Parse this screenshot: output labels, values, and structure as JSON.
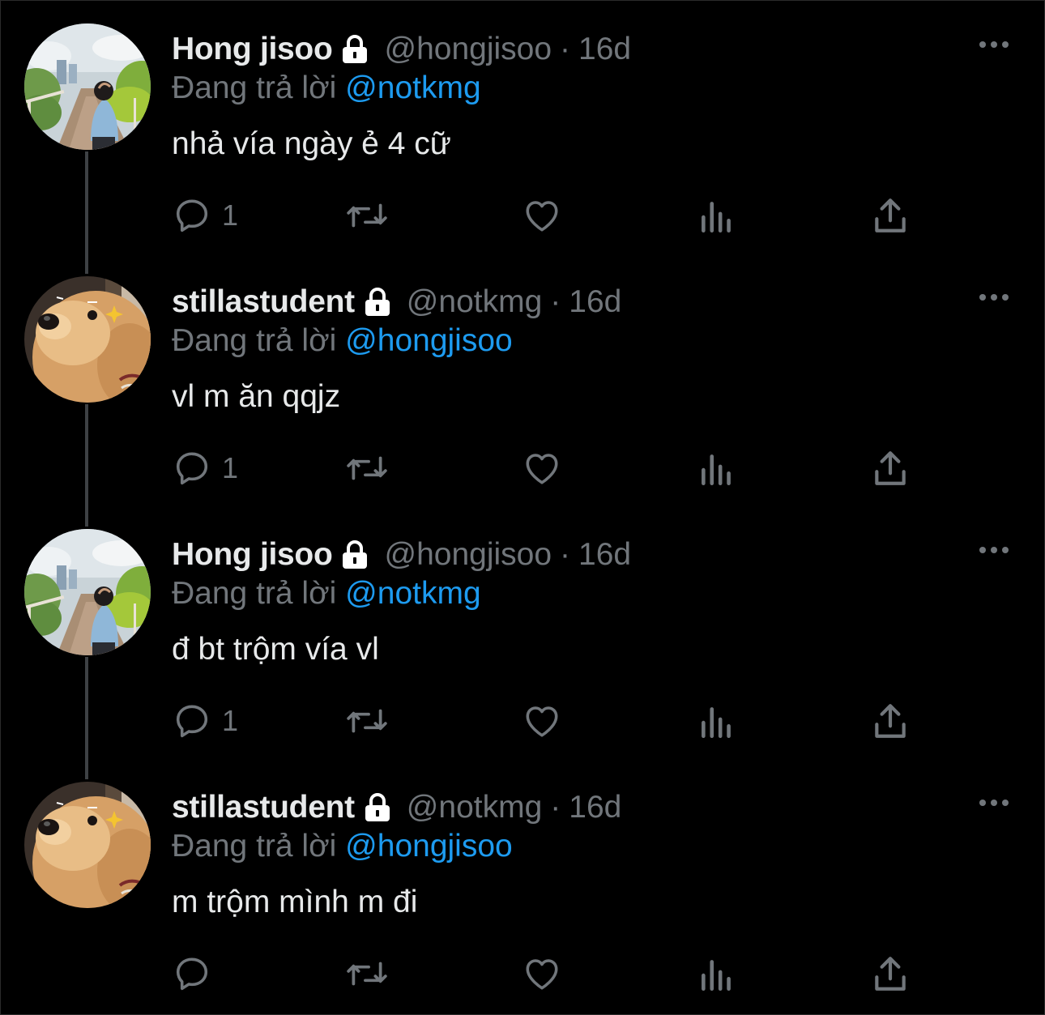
{
  "colors": {
    "background": "#000000",
    "text": "#e7e9ea",
    "muted": "#71767b",
    "link": "#1d9bf0",
    "thread_line": "#3e4144"
  },
  "tweets": [
    {
      "display_name": "Hong jisoo",
      "handle": "@hongjisoo",
      "separator": "·",
      "time": "16d",
      "reply_prefix": "Đang trả lời",
      "reply_to": "@notkmg",
      "text": "nhả vía ngày ẻ 4 cữ",
      "reply_count": "1",
      "avatar": "person-avatar",
      "protected_icon": "lock-icon"
    },
    {
      "display_name": "stillastudent",
      "handle": "@notkmg",
      "separator": "·",
      "time": "16d",
      "reply_prefix": "Đang trả lời",
      "reply_to": "@hongjisoo",
      "text": "vl m ăn qqjz",
      "reply_count": "1",
      "avatar": "dog-avatar",
      "protected_icon": "lock-icon"
    },
    {
      "display_name": "Hong jisoo",
      "handle": "@hongjisoo",
      "separator": "·",
      "time": "16d",
      "reply_prefix": "Đang trả lời",
      "reply_to": "@notkmg",
      "text": "đ bt trộm vía vl",
      "reply_count": "1",
      "avatar": "person-avatar",
      "protected_icon": "lock-icon"
    },
    {
      "display_name": "stillastudent",
      "handle": "@notkmg",
      "separator": "·",
      "time": "16d",
      "reply_prefix": "Đang trả lời",
      "reply_to": "@hongjisoo",
      "text": "m trộm mình m đi",
      "reply_count": "",
      "avatar": "dog-avatar",
      "protected_icon": "lock-icon"
    }
  ],
  "action_icons": [
    "reply-icon",
    "retweet-icon",
    "like-icon",
    "views-icon",
    "share-icon"
  ],
  "more_icon": "more-options-icon"
}
